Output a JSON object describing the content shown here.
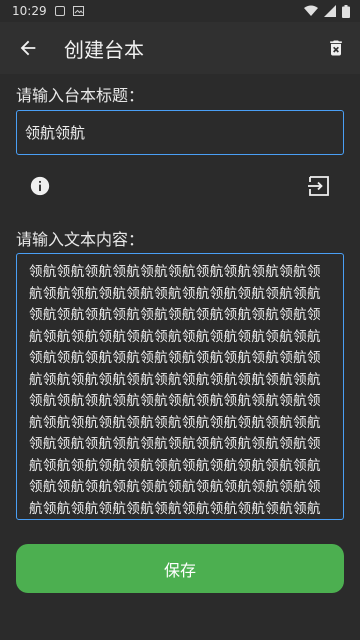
{
  "status_bar": {
    "time": "10:29"
  },
  "header": {
    "title": "创建台本",
    "back_icon": "arrow-back-icon",
    "delete_icon": "trash-icon"
  },
  "form": {
    "title_label": "请输入台本标题：",
    "title_value": "领航领航",
    "content_label": "请输入文本内容：",
    "content_value": "领航领航领航领航领航领航领航领航领航领航领航领航领航领航领航领航领航领航领航领航领航领航领航领航领航领航领航领航领航领航领航领航领航领航领航领航领航领航领航领航领航领航领航领航领航领航领航领航领航领航领航领航领航领航领航领航领航领航领航领航领航领航领航领航领航领航领航领航领航领航领航领航领航领航领航领航领航领航领航领航领航领航领航领航领航领航领航领航领航领航领航领航领航领航领航领航领航领航领航领航领航领航领航领航领航领航领航领航领航领航领航领航领航领航领航领航领航领航领航领航领航领航领航领航领航领航领航领航领航",
    "info_icon": "info-icon",
    "import_icon": "import-icon"
  },
  "actions": {
    "save_label": "保存"
  },
  "colors": {
    "accent_border": "#4a9ff5",
    "save_button": "#4caf50",
    "background": "#2b2b2b"
  }
}
